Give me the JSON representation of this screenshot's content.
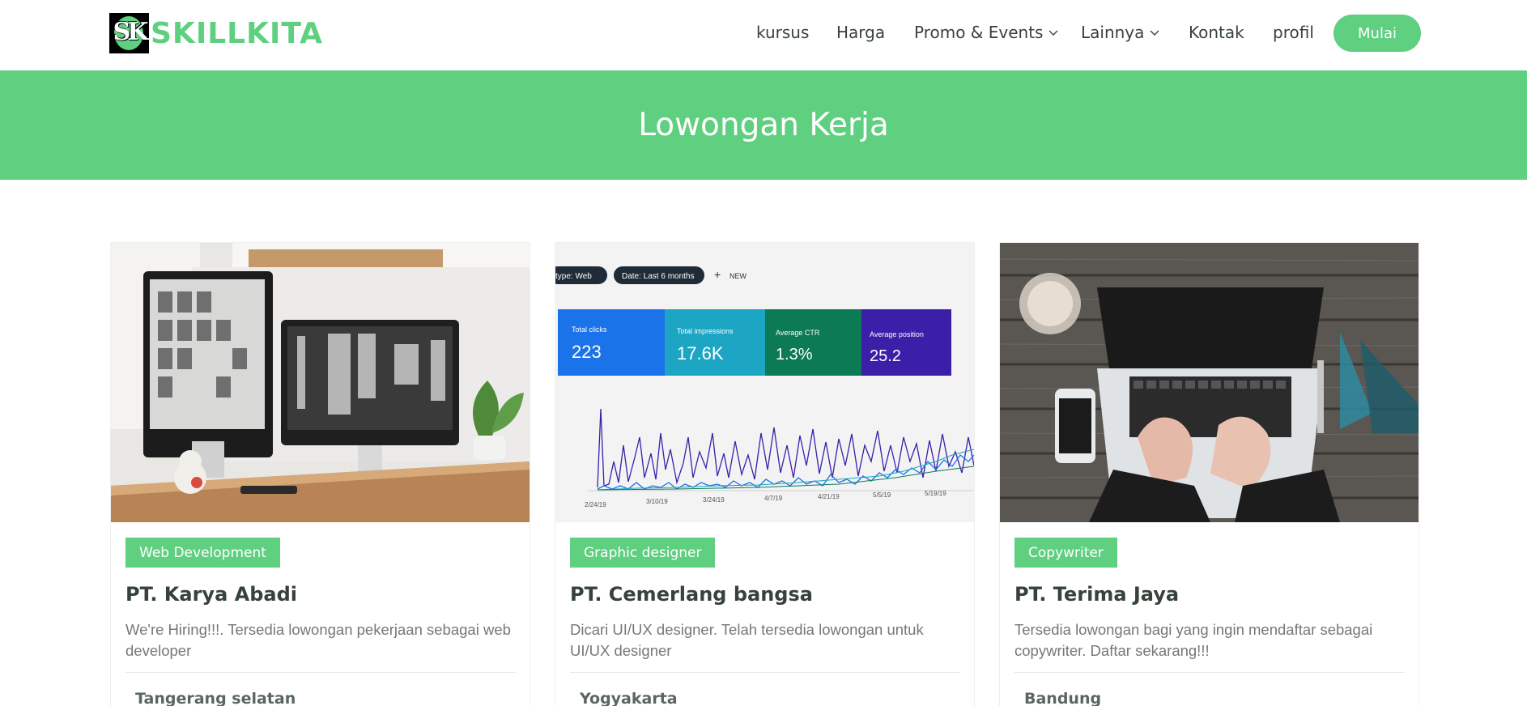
{
  "brand": {
    "logo_letters": "SK",
    "name": "SKILLKITA",
    "color": "#5fcf80"
  },
  "nav": {
    "items": [
      {
        "label": "kursus"
      },
      {
        "label": "Harga"
      },
      {
        "label": "Promo & Events",
        "dropdown": true
      },
      {
        "label": "Lainnya",
        "dropdown": true
      },
      {
        "label": "Kontak"
      },
      {
        "label": "profil"
      }
    ],
    "cta_label": "Mulai"
  },
  "banner": {
    "title": "Lowongan Kerja"
  },
  "dashboard_image": {
    "filter_type": "type: Web",
    "filter_date": "Date: Last 6 months",
    "new_label": "NEW",
    "metrics": [
      {
        "label": "Total clicks",
        "value": "223",
        "color": "#1a73e8"
      },
      {
        "label": "Total impressions",
        "value": "17.6K",
        "color": "#1da5c4"
      },
      {
        "label": "Average CTR",
        "value": "1.3%",
        "color": "#0b7a55"
      },
      {
        "label": "Average position",
        "value": "25.2",
        "color": "#3c1fa8"
      }
    ],
    "dates": [
      "2/24/19",
      "3/10/19",
      "3/24/19",
      "4/7/19",
      "4/21/19",
      "5/5/19",
      "5/19/19"
    ]
  },
  "jobs": [
    {
      "category": "Web Development",
      "company": "PT. Karya Abadi",
      "description": "We're Hiring!!!. Tersedia lowongan pekerjaan sebagai web developer",
      "location": "Tangerang selatan",
      "image": "desk-computers-photo"
    },
    {
      "category": "Graphic designer",
      "company": "PT. Cemerlang bangsa",
      "description": "Dicari UI/UX designer. Telah tersedia lowongan untuk UI/UX designer",
      "location": "Yogyakarta",
      "image": "analytics-dashboard-photo"
    },
    {
      "category": "Copywriter",
      "company": "PT. Terima Jaya",
      "description": "Tersedia lowongan bagi yang ingin mendaftar sebagai copywriter. Daftar sekarang!!!",
      "location": "Bandung",
      "image": "laptop-typing-photo"
    }
  ]
}
